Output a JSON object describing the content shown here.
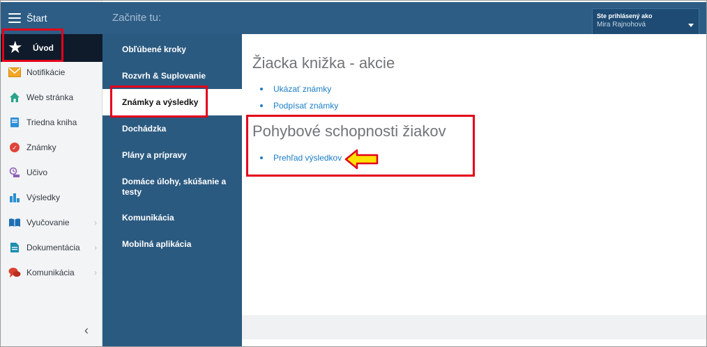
{
  "sidebar": {
    "header_label": "Štart",
    "active_label": "Úvod",
    "items": [
      {
        "label": "Notifikácie",
        "icon": "envelope-icon",
        "chevron": false
      },
      {
        "label": "Web stránka",
        "icon": "home-icon",
        "chevron": false
      },
      {
        "label": "Triedna kniha",
        "icon": "book-icon",
        "chevron": false
      },
      {
        "label": "Známky",
        "icon": "grade-badge-icon",
        "chevron": false
      },
      {
        "label": "Učivo",
        "icon": "curriculum-icon",
        "chevron": false
      },
      {
        "label": "Výsledky",
        "icon": "bar-chart-icon",
        "chevron": false
      },
      {
        "label": "Vyučovanie",
        "icon": "open-book-icon",
        "chevron": true
      },
      {
        "label": "Dokumentácia",
        "icon": "document-icon",
        "chevron": true
      },
      {
        "label": "Komunikácia",
        "icon": "chat-icon",
        "chevron": true
      }
    ],
    "collapse_glyph": "‹",
    "chevron_glyph": "›"
  },
  "topbar": {
    "title": "Začnite tu:",
    "user_label": "Ste prihlásený ako",
    "user_name": "Mira Rajnohová"
  },
  "submenu": {
    "items": [
      {
        "label": "Obľúbené kroky",
        "active": false
      },
      {
        "label": "Rozvrh & Suplovanie",
        "active": false
      },
      {
        "label": "Známky a výsledky",
        "active": true
      },
      {
        "label": "Dochádzka",
        "active": false
      },
      {
        "label": "Plány a prípravy",
        "active": false
      },
      {
        "label": "Domáce úlohy, skúšanie a testy",
        "active": false
      },
      {
        "label": "Komunikácia",
        "active": false
      },
      {
        "label": "Mobilná aplikácia",
        "active": false
      }
    ]
  },
  "content": {
    "section1_title": "Žiacka knižka - akcie",
    "section1_links": [
      "Ukázať známky",
      "Podpísať známky"
    ],
    "section2_title": "Pohybové schopnosti žiakov",
    "section2_links": [
      "Prehľad výsledkov"
    ]
  },
  "colors": {
    "header_blue": "#2d5d85",
    "submenu_blue": "#2b5a80",
    "highlight_red": "#e3001b",
    "arrow_yellow": "#ffe100",
    "link_blue": "#1a7dc6"
  }
}
